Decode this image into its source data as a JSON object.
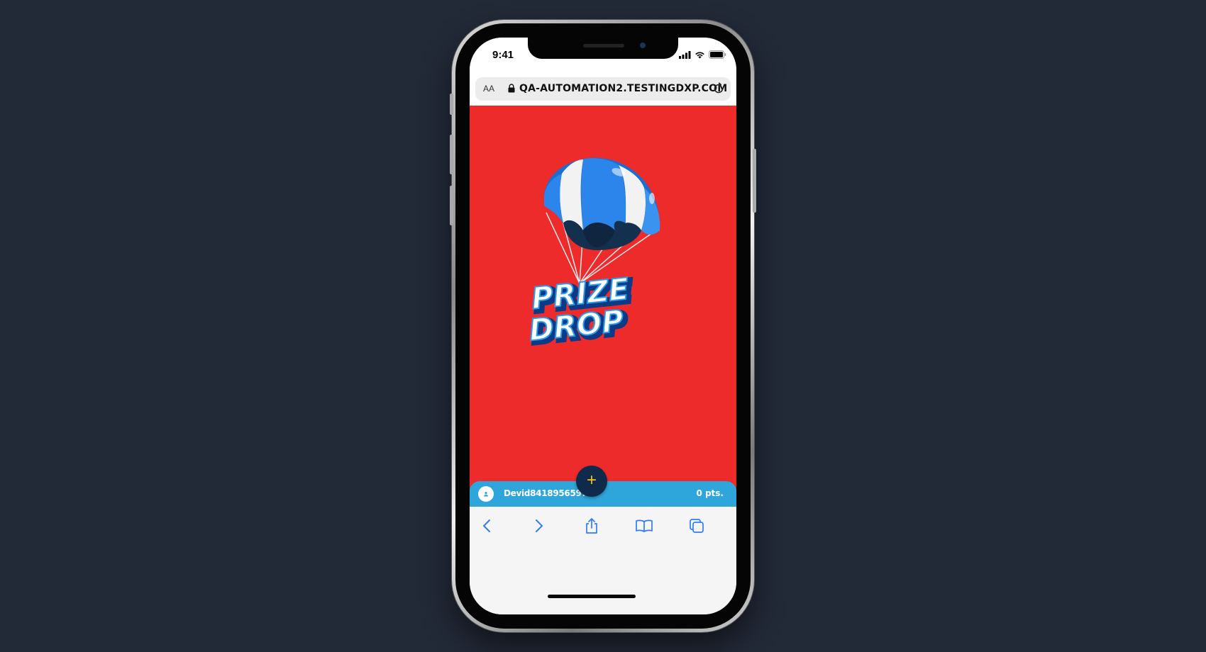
{
  "status_bar": {
    "time": "9:41"
  },
  "address_bar": {
    "text_size_label": "AA",
    "url": "QA-AUTOMATION2.TESTINGDXP.COM"
  },
  "page": {
    "background_color": "#ee2b2b",
    "logo": {
      "line1": "PRIZE",
      "line2": "DROP"
    }
  },
  "fab": {
    "label": "+"
  },
  "user_bar": {
    "username": "Devid8418956597",
    "points": "0 pts."
  },
  "toolbar": {
    "buttons": [
      "back-icon",
      "forward-icon",
      "share-icon",
      "bookmarks-icon",
      "tabs-icon"
    ]
  }
}
